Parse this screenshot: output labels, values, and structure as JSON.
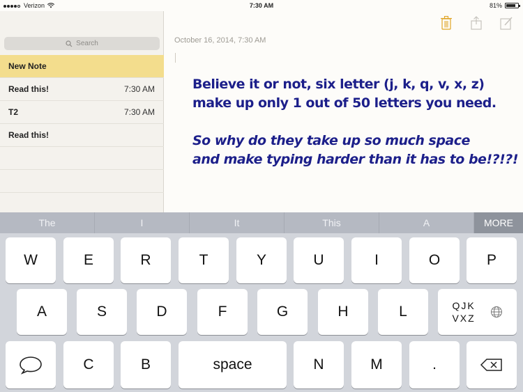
{
  "status_bar": {
    "carrier": "Verizon",
    "time": "7:30 AM",
    "battery_percent": "81%",
    "battery_level": 0.81
  },
  "sidebar": {
    "search_placeholder": "Search",
    "notes": [
      {
        "title": "New Note",
        "time": "",
        "selected": true
      },
      {
        "title": "Read this!",
        "time": "7:30 AM",
        "selected": false
      },
      {
        "title": "T2",
        "time": "7:30 AM",
        "selected": false
      },
      {
        "title": "Read this!",
        "time": "",
        "selected": false
      }
    ]
  },
  "toolbar": {
    "icons": [
      "trash-icon",
      "share-icon",
      "compose-icon"
    ],
    "trash_color": "#e0a526"
  },
  "note": {
    "date": "October 16, 2014, 7:30 AM",
    "line1": "Believe it or not, six letter (j, k, q, v, x, z)",
    "line2": "make up only 1 out of 50 letters you need.",
    "line3": "So why do they take up so much space",
    "line4": "and make typing harder than it has to be!?!?!",
    "text_color": "#1c1f8a"
  },
  "keyboard": {
    "suggestions": [
      "The",
      "I",
      "It",
      "This",
      "A"
    ],
    "more_label": "MORE",
    "row1": [
      "W",
      "E",
      "R",
      "T",
      "Y",
      "U",
      "I",
      "O",
      "P"
    ],
    "row2": [
      "A",
      "S",
      "D",
      "F",
      "G",
      "H",
      "L"
    ],
    "qjk_line1": "QJK",
    "qjk_line2": "VXZ",
    "row3_left": "C",
    "row3_b": "B",
    "space_label": "space",
    "row3_n": "N",
    "row3_m": "M",
    "row3_period": "."
  }
}
